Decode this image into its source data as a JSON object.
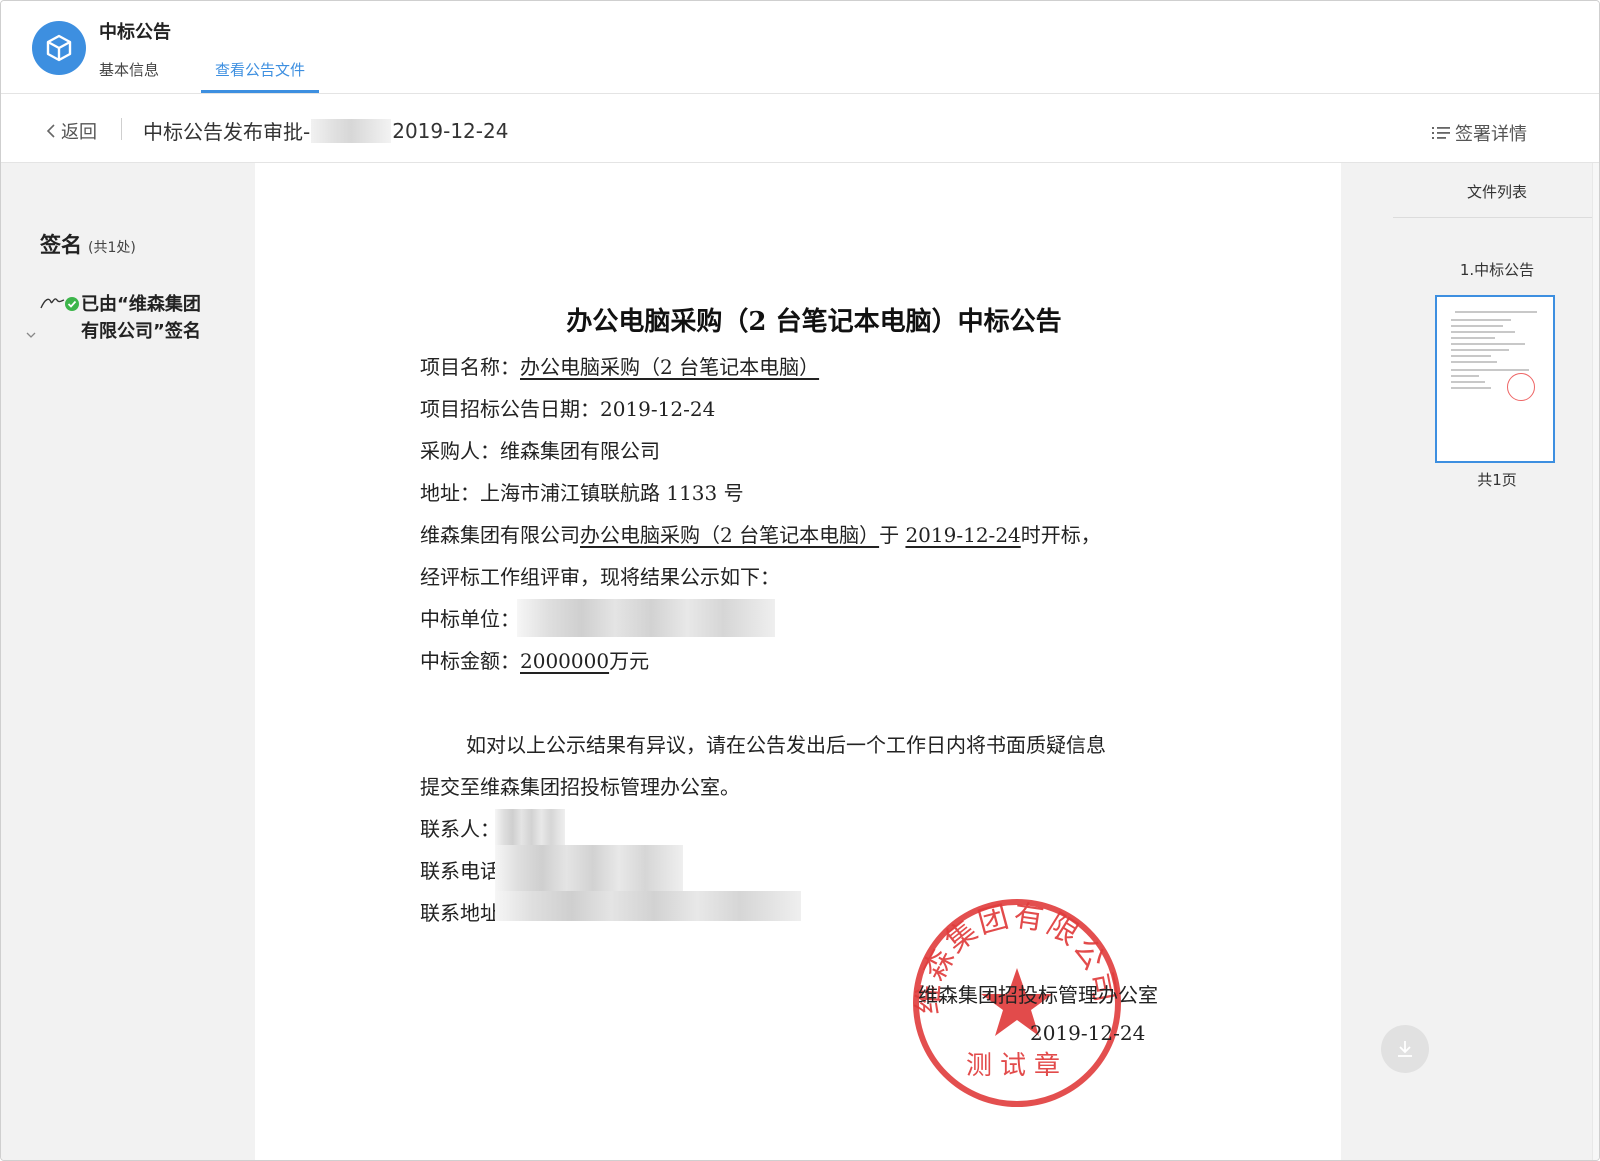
{
  "header": {
    "app_title": "中标公告",
    "tabs": [
      {
        "label": "基本信息",
        "active": false
      },
      {
        "label": "查看公告文件",
        "active": true
      }
    ]
  },
  "toolbar": {
    "back_label": "返回",
    "doc_title_prefix": "中标公告发布审批-",
    "doc_title_date": "2019-12-24",
    "sign_detail_label": "签署详情"
  },
  "signatures": {
    "title": "签名",
    "count_label": "(共1处)",
    "items": [
      {
        "text": "已由“维森集团有限公司”签名"
      }
    ]
  },
  "document": {
    "heading": "办公电脑采购（2 台笔记本电脑）中标公告",
    "project_name_label": "项目名称：",
    "project_name": "办公电脑采购（2 台笔记本电脑）",
    "notice_date_label": "项目招标公告日期：",
    "notice_date": "2019-12-24",
    "buyer_label": "采购人：",
    "buyer": "维森集团有限公司",
    "address_label": "地址：",
    "address": "上海市浦江镇联航路 1133 号",
    "open_line_a": "维森集团有限公司",
    "open_line_b": "办公电脑采购（2 台笔记本电脑）",
    "open_line_c": "于",
    "open_line_d": "2019-12-24",
    "open_line_e": "时开标，",
    "review_line": "经评标工作组评审，现将结果公示如下：",
    "winner_label": "中标单位：",
    "amount_label": "中标金额：",
    "amount_value": "2000000",
    "amount_unit": "万元",
    "objection_1": "如对以上公示结果有异议，请在公告发出后一个工作日内将书面质疑信息",
    "objection_2": "提交至维森集团招投标管理办公室。",
    "contact_label": "联系人：",
    "phone_label": "联系电话",
    "contact_address_label": "联系地址",
    "issuer": "维森集团招投标管理办公室",
    "issue_date": "2019-12-24",
    "seal": {
      "org": "维森集团有限公司",
      "bottom": "测试章",
      "color": "#e03c3c"
    }
  },
  "file_list": {
    "title": "文件列表",
    "files": [
      {
        "name": "1.中标公告"
      }
    ],
    "page_count": "共1页"
  },
  "colors": {
    "accent": "#3d8fe0",
    "check": "#3cb54a",
    "seal": "#e03c3c"
  }
}
